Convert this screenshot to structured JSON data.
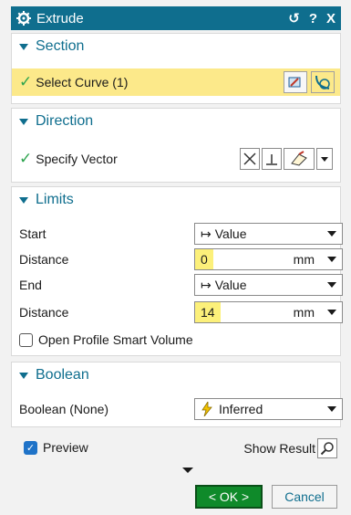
{
  "window": {
    "title": "Extrude"
  },
  "titlebar": {
    "reset": "↺",
    "help": "?",
    "close": "X"
  },
  "section": {
    "header": "Section",
    "select_curve": "Select Curve (1)"
  },
  "direction": {
    "header": "Direction",
    "specify_vector": "Specify Vector"
  },
  "limits": {
    "header": "Limits",
    "start_label": "Start",
    "start_value": "Value",
    "distance1_label": "Distance",
    "distance1_value": "0",
    "distance1_unit": "mm",
    "end_label": "End",
    "end_value": "Value",
    "distance2_label": "Distance",
    "distance2_value": "14",
    "distance2_unit": "mm",
    "open_profile": "Open Profile Smart Volume"
  },
  "boolean": {
    "header": "Boolean",
    "label": "Boolean (None)",
    "value": "Inferred"
  },
  "footer": {
    "preview": "Preview",
    "show_result": "Show Result",
    "ok": "< OK >",
    "cancel": "Cancel"
  }
}
